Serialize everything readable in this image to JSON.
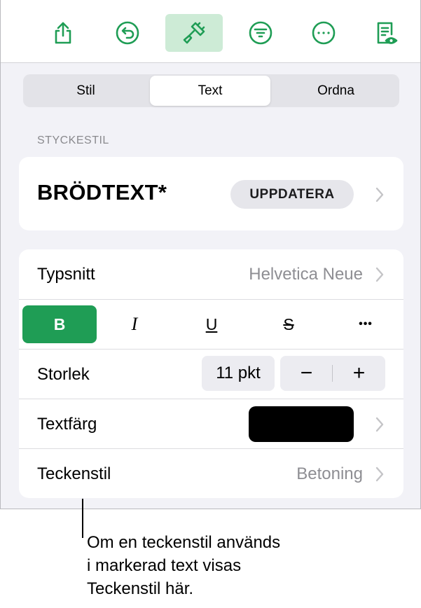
{
  "toolbar": {
    "tools": [
      {
        "icon": "share-icon",
        "active": false
      },
      {
        "icon": "undo-icon",
        "active": false
      },
      {
        "icon": "paintbrush-icon",
        "active": true
      },
      {
        "icon": "organize-icon",
        "active": false
      },
      {
        "icon": "more-icon",
        "active": false
      },
      {
        "icon": "reader-view-icon",
        "active": false
      }
    ],
    "accent": "#1f9d55"
  },
  "tabs": [
    {
      "label": "Stil",
      "active": false
    },
    {
      "label": "Text",
      "active": true
    },
    {
      "label": "Ordna",
      "active": false
    }
  ],
  "paragraph_style": {
    "section_label": "STYCKESTIL",
    "name": "BRÖDTEXT*",
    "update_label": "UPPDATERA"
  },
  "font": {
    "label": "Typsnitt",
    "value": "Helvetica Neue"
  },
  "format_buttons": {
    "bold": "B",
    "italic": "I",
    "underline": "U",
    "strikethrough": "S",
    "more": "•••"
  },
  "size": {
    "label": "Storlek",
    "value": "11 pkt",
    "minus": "−",
    "plus": "+"
  },
  "text_color": {
    "label": "Textfärg",
    "color": "#000000"
  },
  "character_style": {
    "label": "Teckenstil",
    "value": "Betoning"
  },
  "callout": {
    "line1": "Om en teckenstil används",
    "line2": "i markerad text visas",
    "line3": "Teckenstil här."
  }
}
